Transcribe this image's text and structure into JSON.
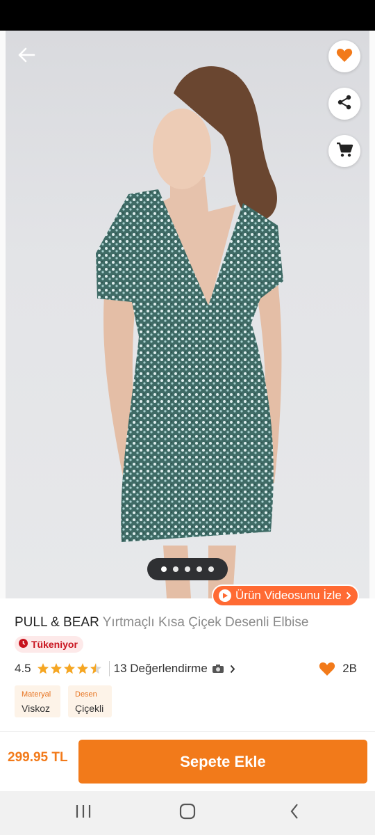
{
  "product": {
    "brand": "PULL & BEAR",
    "name": "Yırtmaçlı Kısa Çiçek Desenli Elbise",
    "stock_badge": "Tükeniyor",
    "rating": "4.5",
    "rating_stars": 4.5,
    "reviews_label": "13 Değerlendirme",
    "favorites_count": "2B",
    "attributes": [
      {
        "key": "Materyal",
        "value": "Viskoz"
      },
      {
        "key": "Desen",
        "value": "Çiçekli"
      }
    ],
    "price": "299.95 TL"
  },
  "gallery": {
    "image_count": 5,
    "active_index": 0,
    "video_label": "Ürün Videosunu İzle"
  },
  "actions": {
    "add_to_cart_label": "Sepete Ekle"
  },
  "icons": {
    "back": "arrow-left-icon",
    "favorite": "heart-icon",
    "share": "share-icon",
    "cart": "cart-icon",
    "play": "play-icon",
    "camera": "camera-icon"
  },
  "colors": {
    "accent": "#f27a1a",
    "video_button": "#ff6a33",
    "badge_text": "#c8131e",
    "star": "#f5a623"
  }
}
